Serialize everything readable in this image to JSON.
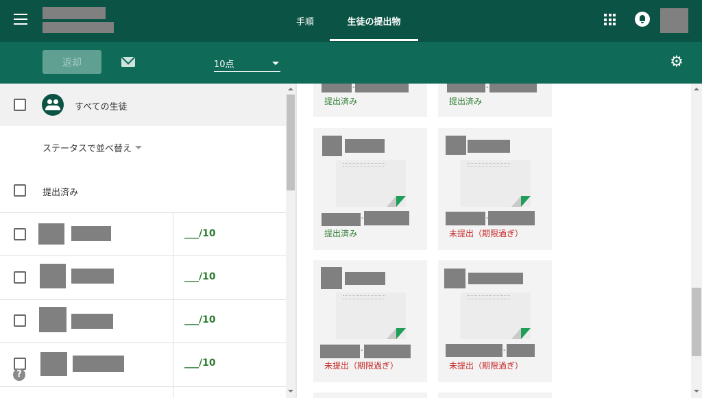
{
  "header": {
    "tabs": [
      {
        "label": "手順",
        "active": false
      },
      {
        "label": "生徒の提出物",
        "active": true
      }
    ]
  },
  "toolbar": {
    "return_label": "返却",
    "points_value": "10点"
  },
  "roster": {
    "all_students_label": "すべての生徒",
    "sort_label": "ステータスで並べ替え",
    "group_label": "提出済み",
    "rows": [
      {
        "score": "___/10"
      },
      {
        "score": "___/10"
      },
      {
        "score": "___/10"
      },
      {
        "score": "___/10"
      }
    ]
  },
  "cards": [
    {
      "status": "提出済み",
      "state": "submitted"
    },
    {
      "status": "提出済み",
      "state": "submitted"
    },
    {
      "status": "提出済み",
      "state": "submitted"
    },
    {
      "status": "未提出（期限過ぎ）",
      "state": "late"
    },
    {
      "status": "未提出（期限過ぎ）",
      "state": "late"
    },
    {
      "status": "未提出（期限過ぎ）",
      "state": "late"
    }
  ],
  "colors": {
    "header": "#0b5344",
    "toolbar": "#0f6b57",
    "submitted": "#2e7d32",
    "late": "#c62828"
  },
  "icons": {
    "menu": "menu-icon",
    "mail": "mail-icon",
    "apps": "apps-icon",
    "notifications": "bell-icon",
    "settings": "gear-icon",
    "people": "people-icon",
    "help": "help-icon"
  }
}
